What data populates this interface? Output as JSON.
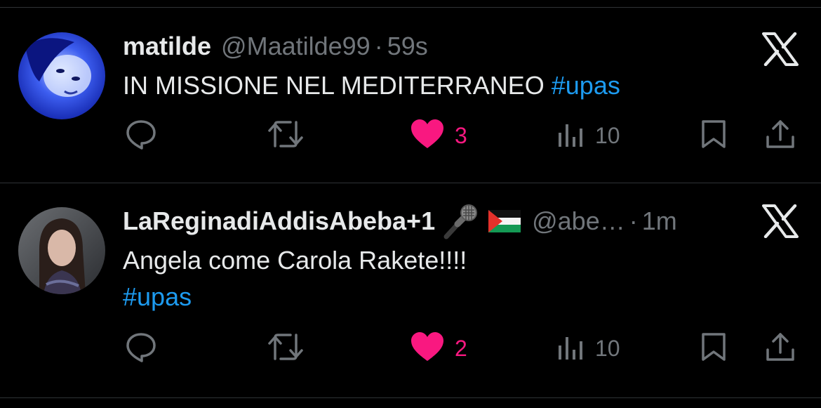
{
  "tweets": [
    {
      "display_name": "matilde",
      "handle": "@Maatilde99",
      "time": "59s",
      "text": "IN MISSIONE NEL MEDITERRANEO",
      "hashtag": "#upas",
      "likes": "3",
      "views": "10",
      "liked": true
    },
    {
      "display_name": "LaReginadiAddisAbeba+1",
      "handle": "@abe…",
      "time": "1m",
      "text": "Angela come Carola Rakete!!!!",
      "hashtag": "#upas",
      "likes": "2",
      "views": "10",
      "liked": true
    }
  ],
  "icons": [
    "reply-icon",
    "retweet-icon",
    "heart-icon",
    "views-icon",
    "bookmark-icon",
    "share-icon",
    "x-logo-icon",
    "microphone-icon",
    "palestine-flag-icon"
  ],
  "colors": {
    "background": "#000000",
    "text": "#e7e9ea",
    "muted": "#71767b",
    "link": "#1d9bf0",
    "like": "#f91880"
  }
}
